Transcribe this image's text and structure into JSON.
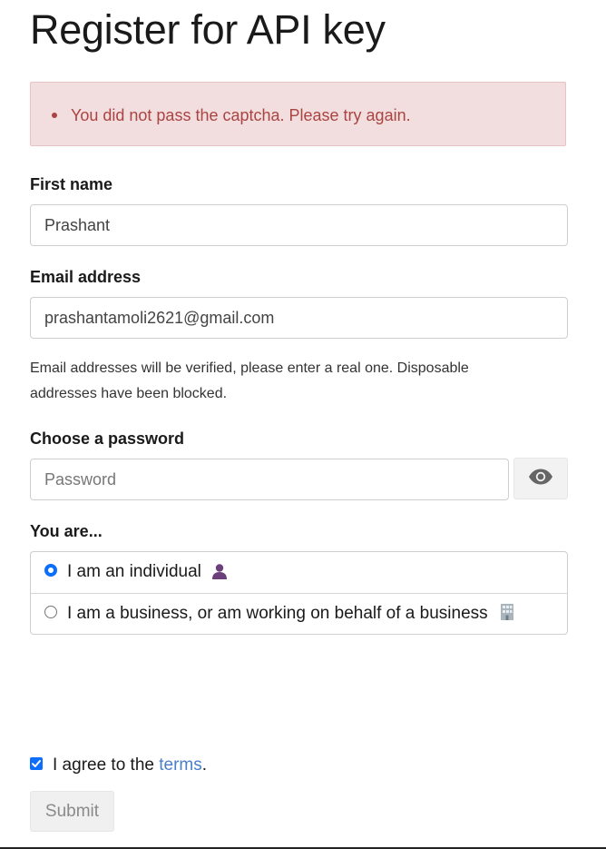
{
  "page": {
    "title": "Register for API key"
  },
  "alert": {
    "message": "You did not pass the captcha. Please try again."
  },
  "form": {
    "first_name": {
      "label": "First name",
      "value": "Prashant"
    },
    "email": {
      "label": "Email address",
      "value": "prashantamoli2621@gmail.com",
      "help": "Email addresses will be verified, please enter a real one. Disposable addresses have been blocked."
    },
    "password": {
      "label": "Choose a password",
      "placeholder": "Password",
      "toggle_icon": "eye-icon"
    },
    "you_are": {
      "label": "You are...",
      "options": [
        {
          "label": "I am an individual",
          "icon": "person-icon",
          "selected": true
        },
        {
          "label": "I am a business, or am working on behalf of a business",
          "icon": "office-building-icon",
          "selected": false
        }
      ]
    },
    "terms": {
      "prefix": "I agree to the ",
      "link": "terms",
      "suffix": ".",
      "checked": true
    },
    "submit_label": "Submit"
  },
  "colors": {
    "alert_bg": "#f2dede",
    "alert_text": "#a94442",
    "link": "#4a7ec9",
    "accent": "#0d6efd",
    "person_icon": "#6b3f7a"
  }
}
